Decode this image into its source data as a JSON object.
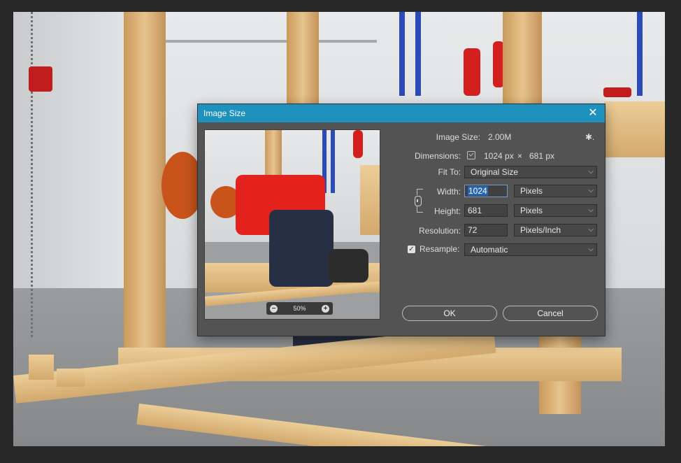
{
  "dialog": {
    "title": "Image Size",
    "close_glyph": "✕"
  },
  "preview": {
    "zoom": "50%",
    "zoom_out_glyph": "−",
    "zoom_in_glyph": "+"
  },
  "image_size": {
    "label": "Image Size:",
    "value": "2.00M",
    "settings_glyph": "✱."
  },
  "dimensions": {
    "label": "Dimensions:",
    "width": "1024 px",
    "times": "×",
    "height": "681 px"
  },
  "fit_to": {
    "label": "Fit To:",
    "value": "Original Size"
  },
  "width": {
    "label": "Width:",
    "value": "1024",
    "unit": "Pixels"
  },
  "height": {
    "label": "Height:",
    "value": "681",
    "unit": "Pixels"
  },
  "resolution": {
    "label": "Resolution:",
    "value": "72",
    "unit": "Pixels/Inch"
  },
  "resample": {
    "label": "Resample:",
    "checked": true,
    "check_glyph": "✓",
    "value": "Automatic"
  },
  "buttons": {
    "ok": "OK",
    "cancel": "Cancel"
  },
  "chevron_glyph": "⌵",
  "colors": {
    "titlebar": "#1f91bd",
    "dialog_bg": "#535353",
    "focus": "#6f9bd6"
  }
}
